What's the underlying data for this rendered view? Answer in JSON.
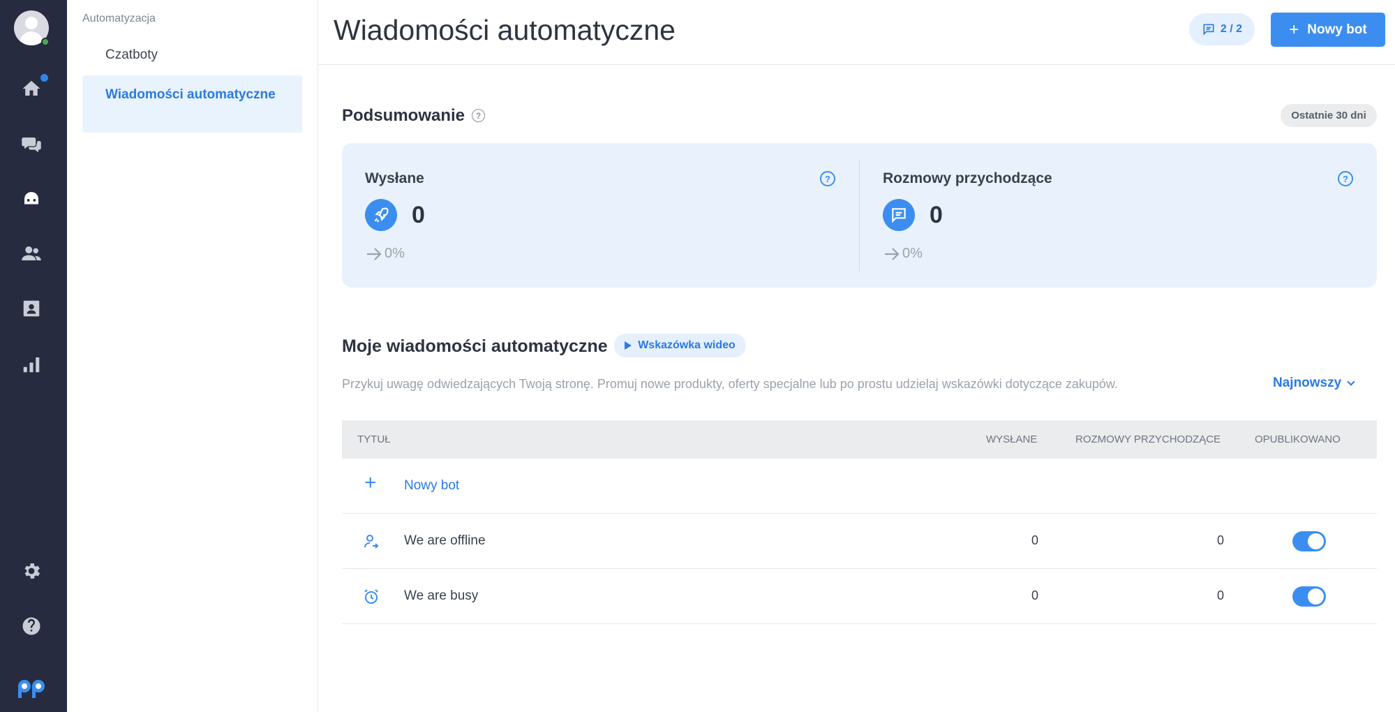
{
  "rail": {
    "icons": [
      "home-icon",
      "chat-icon",
      "bot-icon",
      "people-icon",
      "contacts-icon",
      "stats-icon",
      "settings-icon",
      "help-icon"
    ],
    "active": "bot-icon",
    "logo": "PP"
  },
  "subnav": {
    "section": "Automatyzacja",
    "items": [
      {
        "label": "Czatboty"
      },
      {
        "label": "Wiadomości automatyczne"
      }
    ]
  },
  "header": {
    "title": "Wiadomości automatyczne",
    "count_badge": "2 / 2",
    "new_bot_label": "Nowy bot"
  },
  "summary": {
    "title": "Podsumowanie",
    "period": "Ostatnie 30 dni",
    "stats": [
      {
        "label": "Wysłane",
        "value": "0",
        "trend": "0%",
        "icon": "rocket-icon"
      },
      {
        "label": "Rozmowy przychodzące",
        "value": "0",
        "trend": "0%",
        "icon": "message-icon"
      }
    ]
  },
  "messages": {
    "title": "Moje wiadomości automatyczne",
    "video_hint": "Wskazówka wideo",
    "description": "Przykuj uwagę odwiedzających Twoją stronę. Promuj nowe produkty, oferty specjalne lub po prostu udzielaj wskazówki dotyczące zakupów.",
    "sort_label": "Najnowszy",
    "columns": [
      "TYTUŁ",
      "WYSŁANE",
      "ROZMOWY PRZYCHODZĄCE",
      "OPUBLIKOWANO"
    ],
    "new_bot_row": "Nowy bot",
    "rows": [
      {
        "title": "We are offline",
        "sent": "0",
        "incoming": "0",
        "published": true,
        "icon": "user-offline-icon"
      },
      {
        "title": "We are busy",
        "sent": "0",
        "incoming": "0",
        "published": true,
        "icon": "alarm-clock-icon"
      }
    ]
  },
  "colors": {
    "rail_bg": "#272b40",
    "accent": "#3b8ef0",
    "online": "#43b047"
  }
}
